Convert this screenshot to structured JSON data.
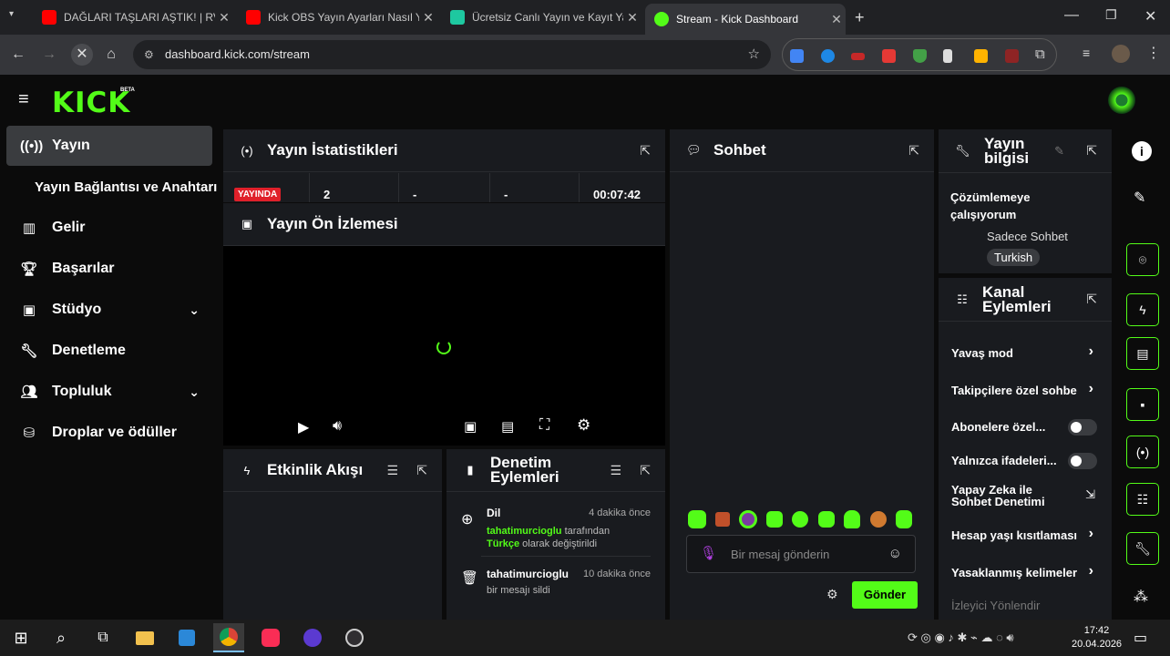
{
  "browser": {
    "tabs": [
      {
        "title": "DAĞLARI TAŞLARI AŞTIK! | RV T",
        "fav_color": "#ff0000"
      },
      {
        "title": "Kick OBS Yayın Ayarları Nasıl Ya",
        "fav_color": "#ff0000"
      },
      {
        "title": "Ücretsiz Canlı Yayın ve Kayıt Yaz",
        "fav_color": "#1ec8a0"
      },
      {
        "title": "Stream - Kick Dashboard",
        "fav_color": "#53fc18"
      }
    ],
    "url": "dashboard.kick.com/stream"
  },
  "brand": {
    "logo": "KICK",
    "badge": "BETA",
    "accent": "#53fc18"
  },
  "sidebar": {
    "items": [
      {
        "label": "Yayın",
        "icon": "broadcast-icon"
      },
      {
        "label": "Yayın Bağlantısı ve Anahtarı"
      },
      {
        "label": "Gelir",
        "icon": "chart-icon"
      },
      {
        "label": "Başarılar",
        "icon": "trophy-icon"
      },
      {
        "label": "Stüdyo",
        "icon": "studio-icon"
      },
      {
        "label": "Denetleme",
        "icon": "wrench-icon"
      },
      {
        "label": "Topluluk",
        "icon": "people-icon"
      },
      {
        "label": "Droplar ve ödüller",
        "icon": "gift-icon"
      }
    ]
  },
  "stats": {
    "title": "Yayın İstatistikleri",
    "live_badge": "YAYINDA",
    "viewers": "2",
    "followers": "-",
    "subs": "-",
    "uptime": "00:07:42"
  },
  "preview": {
    "title": "Yayın Ön İzlemesi"
  },
  "activity": {
    "title": "Etkinlik Akışı"
  },
  "moderation": {
    "title_line1": "Denetim",
    "title_line2": "Eylemleri",
    "entries": [
      {
        "action": "Dil",
        "time": "4 dakika önce",
        "user": "tahatimurcioglu",
        "suffix": "tarafından",
        "value": "Türkçe",
        "rest": "olarak değiştirildi"
      },
      {
        "action": "tahatimurcioglu",
        "time": "10 dakika önce",
        "text": "bir mesajı sildi"
      }
    ]
  },
  "chat": {
    "title": "Sohbet",
    "placeholder": "Bir mesaj gönderin",
    "send": "Gönder"
  },
  "stream_info": {
    "title_line1": "Yayın",
    "title_line2": "bilgisi",
    "stream_title_line1": "Çözümlemeye",
    "stream_title_line2": "çalışıyorum",
    "category": "Sadece Sohbet",
    "tag": "Turkish"
  },
  "channel_actions": {
    "title_line1": "Kanal",
    "title_line2": "Eylemleri",
    "items": [
      {
        "label": "Yavaş mod"
      },
      {
        "label": "Takipçilere özel sohbe"
      },
      {
        "label": "Abonelere özel..."
      },
      {
        "label": "Yalnızca ifadeleri..."
      },
      {
        "label_line1": "Yapay Zeka ile",
        "label_line2": "Sohbet Denetimi"
      },
      {
        "label": "Hesap yaşı kısıtlaması"
      },
      {
        "label": "Yasaklanmış kelimeler"
      },
      {
        "label": "İzleyici Yönlendir"
      }
    ]
  },
  "taskbar": {
    "time": "17:42",
    "date": "20.04.2026"
  }
}
